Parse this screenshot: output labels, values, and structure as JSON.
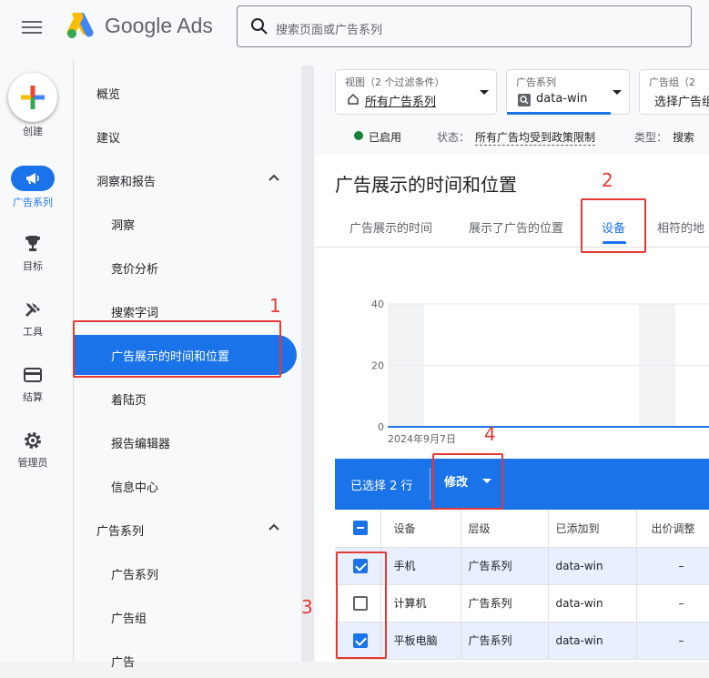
{
  "app": {
    "brand": "Google Ads"
  },
  "search": {
    "placeholder": "搜索页面或广告系列"
  },
  "rail": {
    "create": "创建",
    "items": [
      {
        "label": "广告系列",
        "icon": "megaphone-icon"
      },
      {
        "label": "目标",
        "icon": "trophy-icon"
      },
      {
        "label": "工具",
        "icon": "tools-icon"
      },
      {
        "label": "结算",
        "icon": "credit-card-icon"
      },
      {
        "label": "管理员",
        "icon": "gear-icon"
      }
    ]
  },
  "nav": {
    "overview": "概览",
    "recommendations": "建议",
    "insights_reports": "洞察和报告",
    "insights": "洞察",
    "auction": "竞价分析",
    "search_terms": "搜索字词",
    "when_where": "广告展示的时间和位置",
    "landing_pages": "着陆页",
    "report_editor": "报告编辑器",
    "info_center": "信息中心",
    "campaigns": "广告系列",
    "campaigns_sub": "广告系列",
    "ad_groups": "广告组",
    "ads": "广告"
  },
  "filters": {
    "view_top": "视图（2 个过滤条件）",
    "view_value": "所有广告系列",
    "campaign_top": "广告系列",
    "campaign_value": "data-win",
    "adgroup_top": "广告组（2",
    "adgroup_value": "选择广告组"
  },
  "status": {
    "enabled": "已启用",
    "status_label": "状态：",
    "status_value": "所有广告均受到政策限制",
    "type_label": "类型：",
    "type_value": "搜索"
  },
  "page": {
    "title": "广告展示的时间和位置",
    "tabs": [
      "广告展示的时间",
      "展示了广告的位置",
      "设备",
      "相符的地"
    ]
  },
  "chart_data": {
    "type": "line",
    "y_ticks": [
      "40",
      "20",
      "0"
    ],
    "ylim": [
      0,
      40
    ],
    "x_label_first": "2024年9月7日",
    "grid": true,
    "series": [
      {
        "values": [
          0,
          0,
          0,
          0,
          0,
          0,
          0,
          0
        ]
      }
    ],
    "colors": {
      "line": "#1a73e8",
      "weekend_band": "#f1f3f4"
    }
  },
  "selection": {
    "count_text": "已选择 2 行",
    "modify": "修改"
  },
  "table": {
    "headers": [
      "设备",
      "层级",
      "已添加到",
      "出价调整"
    ],
    "rows": [
      {
        "device": "手机",
        "level": "广告系列",
        "added_to": "data-win",
        "bid": "–",
        "checked": true
      },
      {
        "device": "计算机",
        "level": "广告系列",
        "added_to": "data-win",
        "bid": "–",
        "checked": false
      },
      {
        "device": "平板电脑",
        "level": "广告系列",
        "added_to": "data-win",
        "bid": "–",
        "checked": true
      }
    ]
  },
  "annotations": [
    "1",
    "2",
    "3",
    "4"
  ],
  "colors": {
    "accent": "#1a73e8",
    "annotation": "#e53935",
    "enabled": "#188038"
  }
}
